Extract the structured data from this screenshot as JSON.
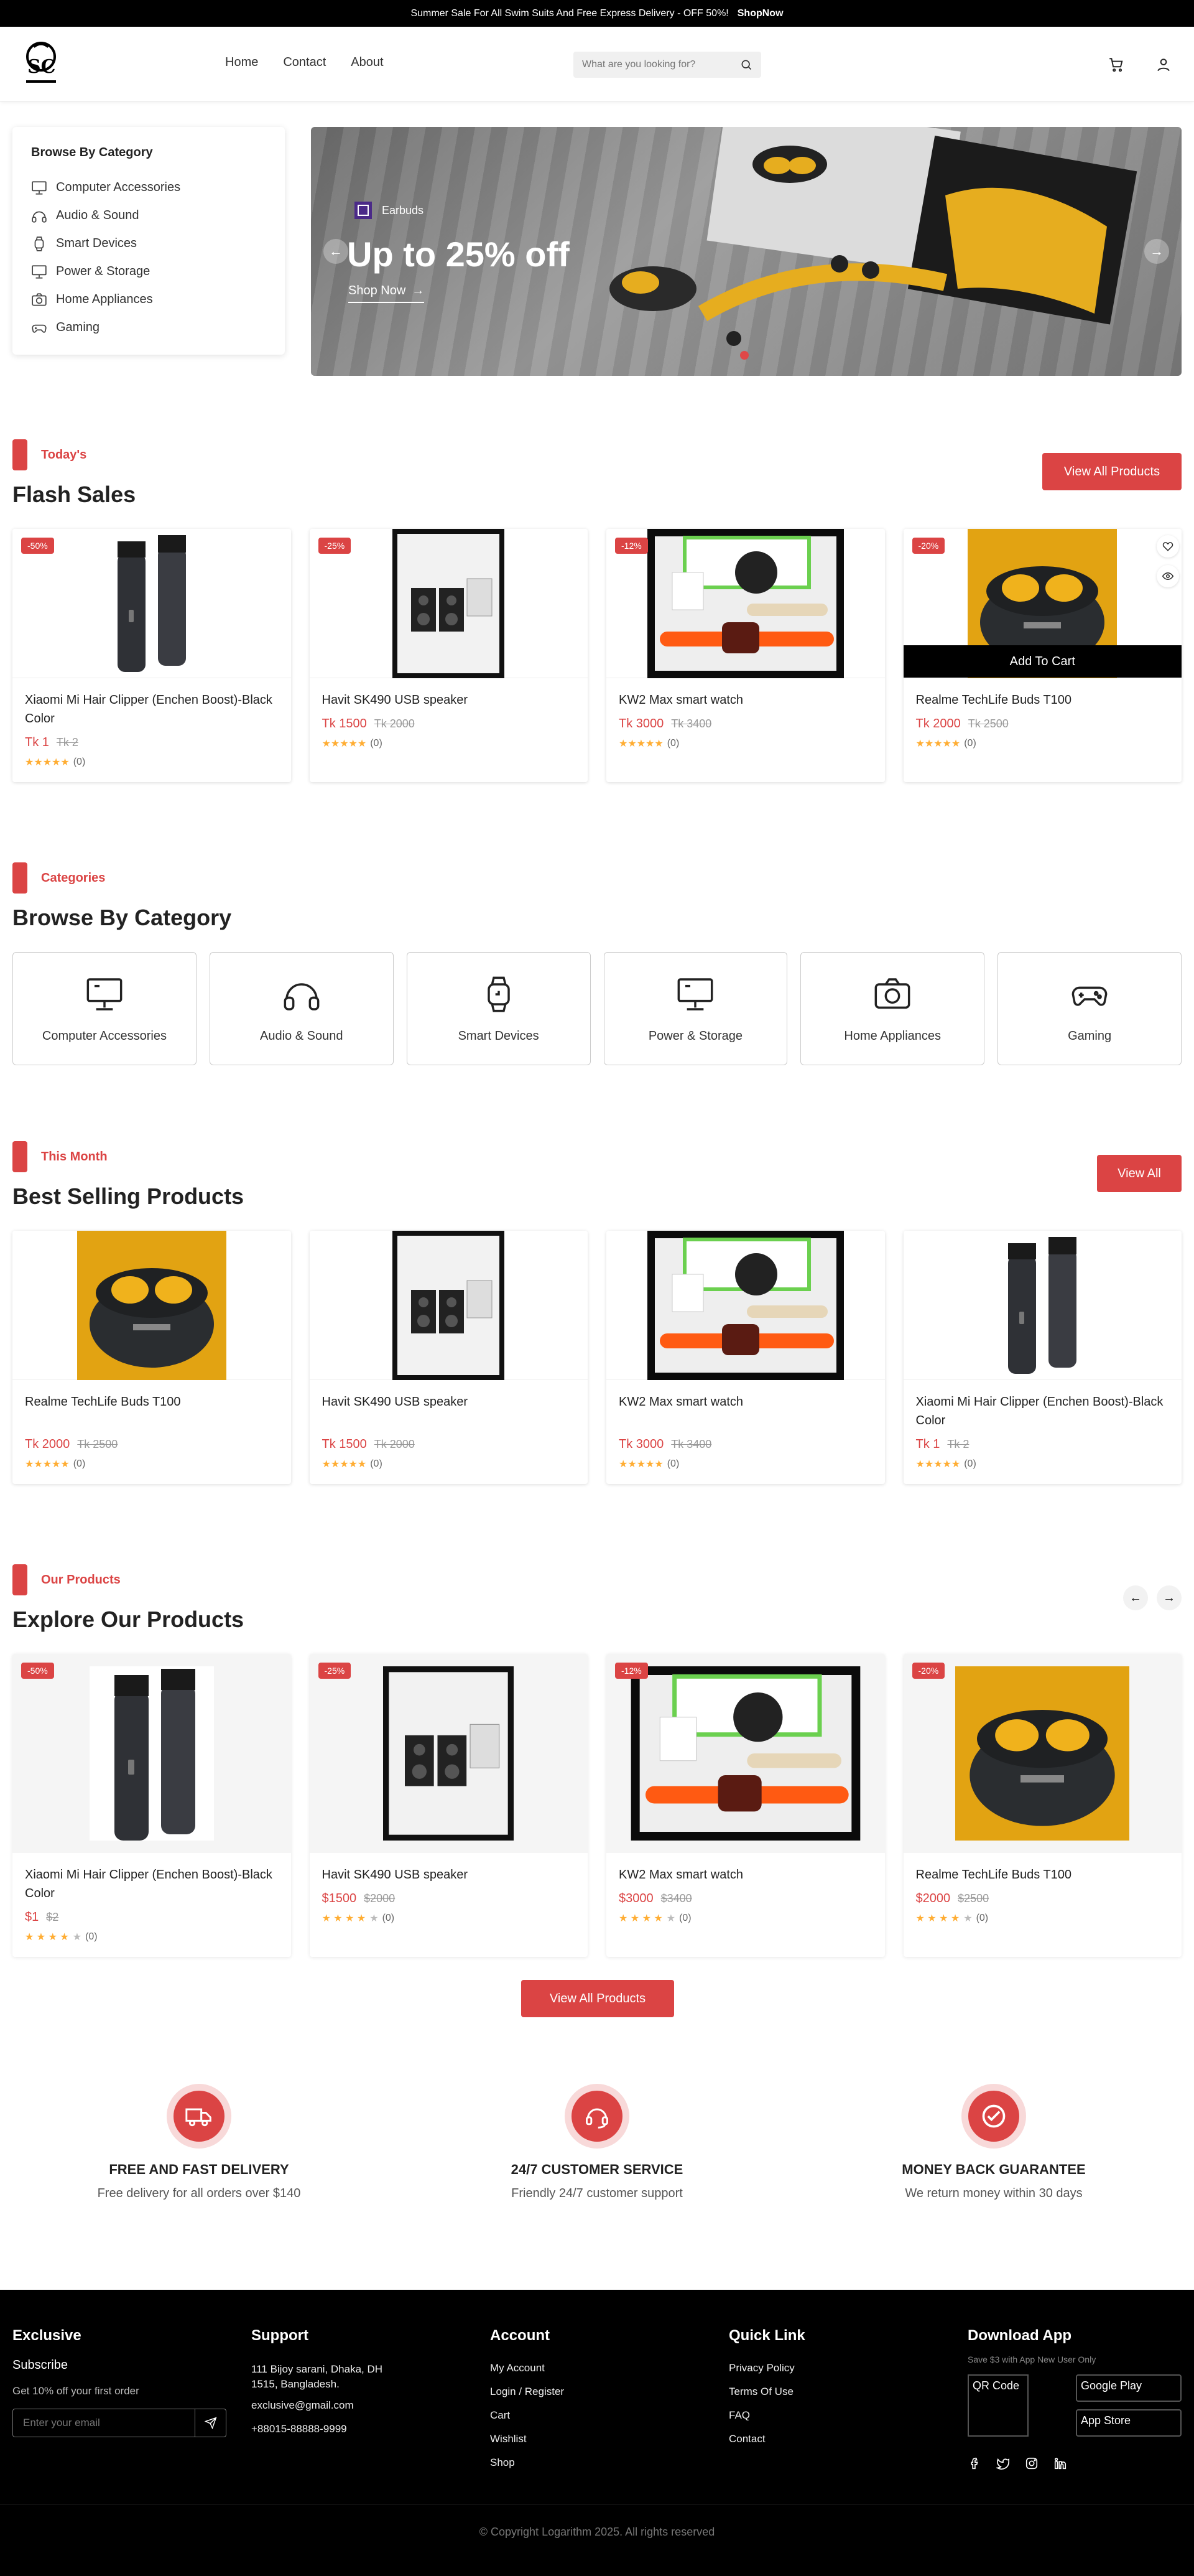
{
  "topbar": {
    "text": "Summer Sale For All Swim Suits And Free Express Delivery - OFF 50%!",
    "link": "ShopNow"
  },
  "header": {
    "nav": [
      "Home",
      "Contact",
      "About"
    ],
    "search_placeholder": "What are you looking for?"
  },
  "sidebar": {
    "title": "Browse By Category",
    "items": [
      "Computer Accessories",
      "Audio & Sound",
      "Smart Devices",
      "Power & Storage",
      "Home Appliances",
      "Gaming"
    ]
  },
  "banner": {
    "brand": "Earbuds",
    "title": "Up to 25% off",
    "cta": "Shop Now"
  },
  "flash": {
    "tag": "Today's",
    "title": "Flash Sales",
    "button": "View All Products",
    "add_to_cart": "Add To Cart",
    "products": [
      {
        "name": "Xiaomi Mi Hair Clipper (Enchen Boost)-Black Color",
        "price": "Tk 1",
        "old": "Tk 2",
        "discount": "-50%",
        "rating": "(0)"
      },
      {
        "name": "Havit SK490 USB speaker",
        "price": "Tk 1500",
        "old": "Tk 2000",
        "discount": "-25%",
        "rating": "(0)"
      },
      {
        "name": "KW2 Max smart watch",
        "price": "Tk 3000",
        "old": "Tk 3400",
        "discount": "-12%",
        "rating": "(0)"
      },
      {
        "name": "Realme TechLife Buds T100",
        "price": "Tk 2000",
        "old": "Tk 2500",
        "discount": "-20%",
        "rating": "(0)"
      }
    ]
  },
  "categories": {
    "tag": "Categories",
    "title": "Browse By Category",
    "items": [
      "Computer Accessories",
      "Audio & Sound",
      "Smart Devices",
      "Power & Storage",
      "Home Appliances",
      "Gaming"
    ]
  },
  "best": {
    "tag": "This Month",
    "title": "Best Selling Products",
    "button": "View All",
    "products": [
      {
        "name": "Realme TechLife Buds T100",
        "price": "Tk 2000",
        "old": "Tk 2500",
        "rating": "(0)"
      },
      {
        "name": "Havit SK490 USB speaker",
        "price": "Tk 1500",
        "old": "Tk 2000",
        "rating": "(0)"
      },
      {
        "name": "KW2 Max smart watch",
        "price": "Tk 3000",
        "old": "Tk 3400",
        "rating": "(0)"
      },
      {
        "name": "Xiaomi Mi Hair Clipper (Enchen Boost)-Black Color",
        "price": "Tk 1",
        "old": "Tk 2",
        "rating": "(0)"
      }
    ]
  },
  "explore": {
    "tag": "Our Products",
    "title": "Explore Our Products",
    "button": "View All Products",
    "products": [
      {
        "name": "Xiaomi Mi Hair Clipper (Enchen Boost)-Black Color",
        "price": "$1",
        "old": "$2",
        "discount": "-50%",
        "rating": "(0)"
      },
      {
        "name": "Havit SK490 USB speaker",
        "price": "$1500",
        "old": "$2000",
        "discount": "-25%",
        "rating": "(0)"
      },
      {
        "name": "KW2 Max smart watch",
        "price": "$3000",
        "old": "$3400",
        "discount": "-12%",
        "rating": "(0)"
      },
      {
        "name": "Realme TechLife Buds T100",
        "price": "$2000",
        "old": "$2500",
        "discount": "-20%",
        "rating": "(0)"
      }
    ]
  },
  "features": [
    {
      "title": "FREE AND FAST DELIVERY",
      "text": "Free delivery for all orders over $140"
    },
    {
      "title": "24/7 CUSTOMER SERVICE",
      "text": "Friendly 24/7 customer support"
    },
    {
      "title": "MONEY BACK GUARANTEE",
      "text": "We return money within 30 days"
    }
  ],
  "footer": {
    "brand": "Exclusive",
    "subscribe": "Subscribe",
    "offer": "Get 10% off your first order",
    "email_placeholder": "Enter your email",
    "support_title": "Support",
    "address": "111 Bijoy sarani, Dhaka, DH 1515, Bangladesh.",
    "email": "exclusive@gmail.com",
    "phone": "+88015-88888-9999",
    "account_title": "Account",
    "account_links": [
      "My Account",
      "Login / Register",
      "Cart",
      "Wishlist",
      "Shop"
    ],
    "quick_title": "Quick Link",
    "quick_links": [
      "Privacy Policy",
      "Terms Of Use",
      "FAQ",
      "Contact"
    ],
    "app_title": "Download App",
    "app_note": "Save $3 with App New User Only",
    "qr_alt": "QR Code",
    "google_alt": "Google Play",
    "appstore_alt": "App Store",
    "copyright": "© Copyright Logarithm 2025. All rights reserved"
  },
  "colors": {
    "accent": "#DB4444",
    "star": "#FFAD33",
    "topbar": "#000000"
  }
}
